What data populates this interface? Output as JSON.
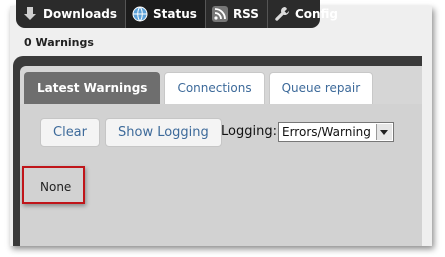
{
  "nav": {
    "items": [
      {
        "label": "Downloads",
        "icon": "downloads-icon"
      },
      {
        "label": "Status",
        "icon": "status-globe-icon",
        "active": true
      },
      {
        "label": "RSS",
        "icon": "rss-icon"
      },
      {
        "label": "Config",
        "icon": "wrench-icon"
      }
    ]
  },
  "status": {
    "warnings_count": "0 Warnings"
  },
  "tabs": [
    {
      "label": "Latest Warnings",
      "active": true
    },
    {
      "label": "Connections"
    },
    {
      "label": "Queue repair"
    }
  ],
  "toolbar": {
    "clear_label": "Clear",
    "show_logging_label": "Show Logging",
    "logging_label": "Logging:",
    "logging_value": "Errors/Warning"
  },
  "content": {
    "empty_text": "None"
  },
  "colors": {
    "highlight_border": "#c0151a",
    "link": "#3d6a9a",
    "navbar": "#2b2b2b"
  }
}
